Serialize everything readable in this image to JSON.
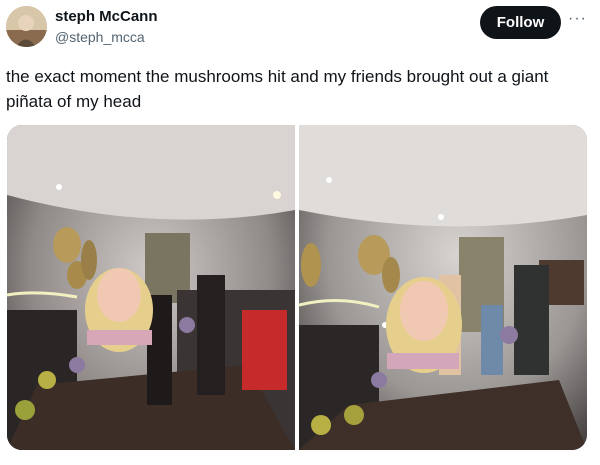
{
  "tweet": {
    "display_name": "steph McCann",
    "handle": "@steph_mcca",
    "follow_label": "Follow",
    "more_label": "···",
    "text": "the exact moment the  mushrooms hit and my friends brought out a giant piñata of my head"
  },
  "colors": {
    "follow_bg": "#0f1419",
    "secondary_text": "#536471"
  },
  "icons": {
    "more": "more-options-icon"
  }
}
